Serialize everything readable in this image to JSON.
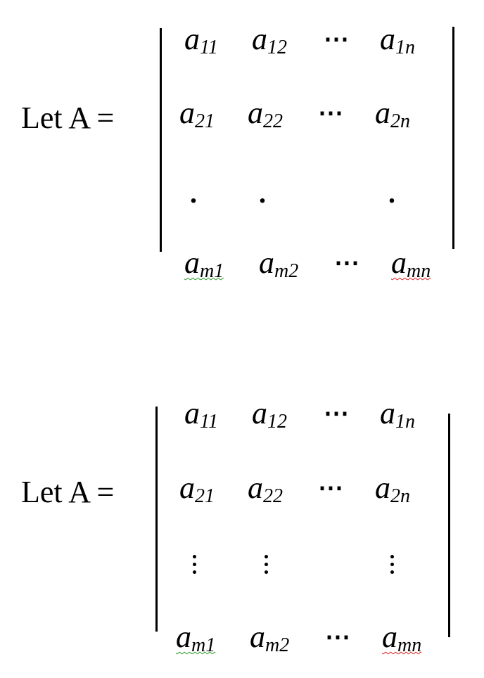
{
  "blocks": [
    {
      "label": "Let A =",
      "rows": [
        [
          {
            "base": "a",
            "sub": "11"
          },
          {
            "base": "a",
            "sub": "12"
          },
          {
            "dots": "⋯"
          },
          {
            "base": "a",
            "sub": "1n"
          }
        ],
        [
          {
            "base": "a",
            "sub": "21"
          },
          {
            "base": "a",
            "sub": "22"
          },
          {
            "dots": "⋯"
          },
          {
            "base": "a",
            "sub": "2n"
          }
        ],
        [
          {
            "dot": "."
          },
          {
            "dot": "."
          },
          {
            "dot": "."
          }
        ],
        [
          {
            "base": "a",
            "sub": "m1",
            "spell": "green"
          },
          {
            "base": "a",
            "sub": "m2"
          },
          {
            "dots": "⋯"
          },
          {
            "base": "a",
            "sub": "mn",
            "spell": "red"
          }
        ]
      ]
    },
    {
      "label": "Let A =",
      "rows": [
        [
          {
            "base": "a",
            "sub": "11"
          },
          {
            "base": "a",
            "sub": "12"
          },
          {
            "dots": "⋯"
          },
          {
            "base": "a",
            "sub": "1n"
          }
        ],
        [
          {
            "base": "a",
            "sub": "21"
          },
          {
            "base": "a",
            "sub": "22"
          },
          {
            "dots": "⋯"
          },
          {
            "base": "a",
            "sub": "2n"
          }
        ],
        [
          {
            "vdots": "vertical-ellipsis-icon"
          },
          {
            "vdots": "vertical-ellipsis-icon"
          },
          {
            "vdots": "vertical-ellipsis-icon"
          }
        ],
        [
          {
            "base": "a",
            "sub": "m1",
            "spell": "green"
          },
          {
            "base": "a",
            "sub": "m2"
          },
          {
            "dots": "⋯"
          },
          {
            "base": "a",
            "sub": "mn",
            "spell": "red"
          }
        ]
      ]
    }
  ],
  "colors": {
    "spell_grammar": "#2a9a2a",
    "spell_error": "#e02020"
  }
}
